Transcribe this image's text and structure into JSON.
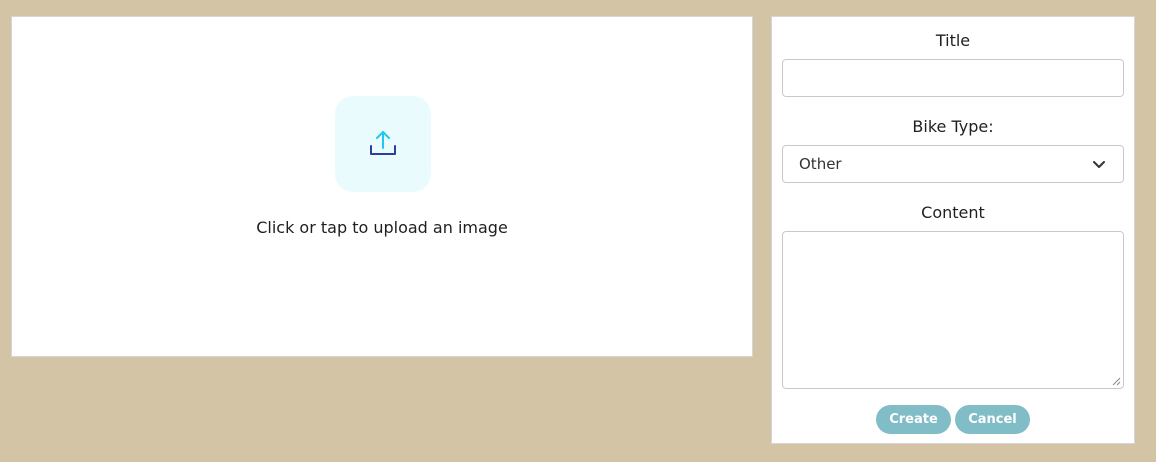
{
  "upload": {
    "prompt": "Click or tap to upload an image",
    "icon": "upload-icon",
    "tile_color": "#eafbfe",
    "arrow_color": "#21c7f0",
    "tray_color": "#2a3f9e"
  },
  "form": {
    "title_label": "Title",
    "title_value": "",
    "bike_type_label": "Bike Type:",
    "bike_type_selected": "Other",
    "content_label": "Content",
    "content_value": "",
    "create_label": "Create",
    "cancel_label": "Cancel",
    "button_color": "#80bdc6"
  },
  "page": {
    "background": "#d3c4a5"
  }
}
